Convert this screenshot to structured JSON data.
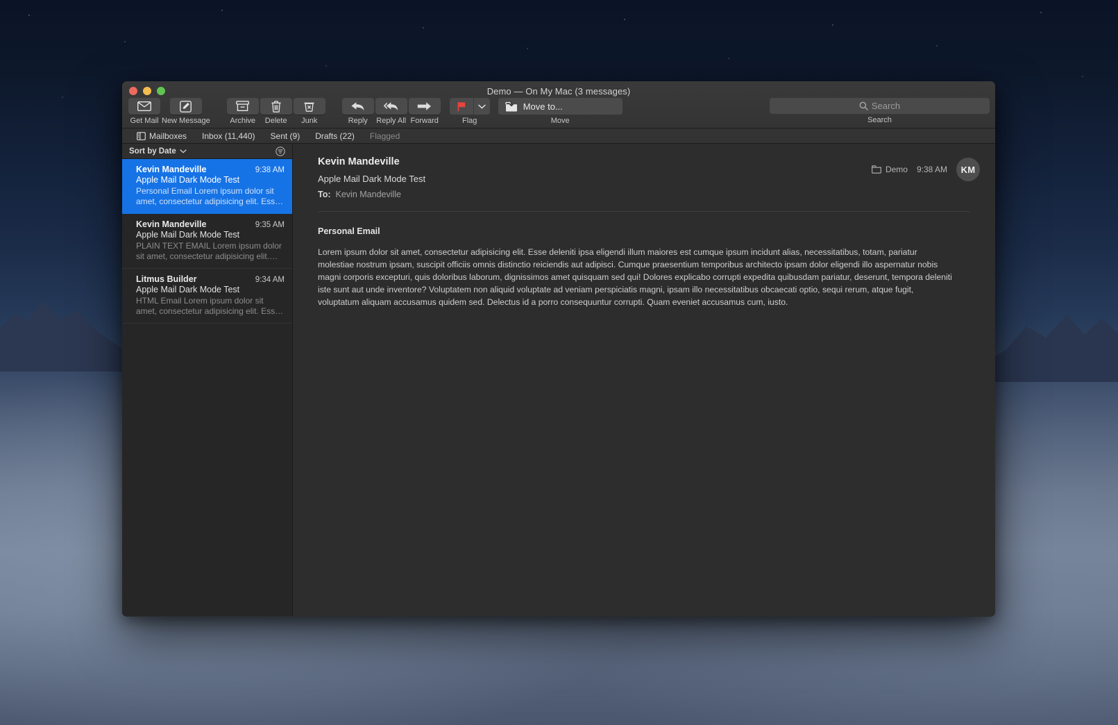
{
  "window": {
    "title": "Demo — On My Mac (3 messages)",
    "traffic_lights": [
      "close",
      "minimize",
      "zoom"
    ],
    "accent_selected": "#1673e6",
    "flag_color": "#e8453c"
  },
  "toolbar": {
    "items": [
      {
        "label": "Get Mail",
        "icon": "envelope-icon"
      },
      {
        "label": "New Message",
        "icon": "compose-icon"
      },
      {
        "label": "Archive",
        "icon": "archive-box-icon"
      },
      {
        "label": "Delete",
        "icon": "trash-icon"
      },
      {
        "label": "Junk",
        "icon": "junk-bin-icon"
      },
      {
        "label": "Reply",
        "icon": "reply-arrow-icon"
      },
      {
        "label": "Reply All",
        "icon": "reply-all-arrow-icon"
      },
      {
        "label": "Forward",
        "icon": "forward-arrow-icon"
      }
    ],
    "flag": {
      "label": "Flag",
      "icon": "flag-icon",
      "menu_icon": "chevron-down-icon"
    },
    "move": {
      "label": "Move",
      "button_label": "Move to...",
      "icon": "move-to-icon"
    },
    "search": {
      "label": "Search",
      "placeholder": "Search",
      "icon": "search-icon"
    }
  },
  "favorites": {
    "items": [
      {
        "label": "Mailboxes",
        "icon": "sidebar-toggle-icon",
        "dim": false
      },
      {
        "label": "Inbox (11,440)",
        "icon": null,
        "dim": false
      },
      {
        "label": "Sent (9)",
        "icon": null,
        "dim": false
      },
      {
        "label": "Drafts (22)",
        "icon": null,
        "dim": false
      },
      {
        "label": "Flagged",
        "icon": null,
        "dim": true
      }
    ]
  },
  "message_list": {
    "sort_label": "Sort by Date",
    "sort_chevron": "chevron-down-icon",
    "filter_icon": "filter-icon",
    "messages": [
      {
        "sender": "Kevin Mandeville",
        "time": "9:38 AM",
        "subject": "Apple Mail Dark Mode Test",
        "snippet": "Personal Email Lorem ipsum dolor sit amet, consectetur adipisicing elit. Ess…",
        "selected": true
      },
      {
        "sender": "Kevin Mandeville",
        "time": "9:35 AM",
        "subject": "Apple Mail Dark Mode Test",
        "snippet": "PLAIN TEXT EMAIL Lorem ipsum dolor sit amet, consectetur adipisicing elit.…",
        "selected": false
      },
      {
        "sender": "Litmus Builder",
        "time": "9:34 AM",
        "subject": "Apple Mail Dark Mode Test",
        "snippet": "HTML Email Lorem ipsum dolor sit amet, consectetur adipisicing elit. Ess…",
        "selected": false
      }
    ]
  },
  "reading_pane": {
    "sender": "Kevin Mandeville",
    "subject": "Apple Mail Dark Mode Test",
    "to_label": "To:",
    "to_value": "Kevin Mandeville",
    "folder": "Demo",
    "folder_icon": "folder-icon",
    "time": "9:38 AM",
    "avatar_initials": "KM",
    "body_heading": "Personal Email",
    "body_text": "Lorem ipsum dolor sit amet, consectetur adipisicing elit. Esse deleniti ipsa eligendi illum maiores est cumque ipsum incidunt alias, necessitatibus, totam, pariatur molestiae nostrum ipsam, suscipit officiis omnis distinctio reiciendis aut adipisci. Cumque praesentium temporibus architecto ipsam dolor eligendi illo aspernatur nobis magni corporis excepturi, quis doloribus laborum, dignissimos amet quisquam sed qui! Dolores explicabo corrupti expedita quibusdam pariatur, deserunt, tempora deleniti iste sunt aut unde inventore? Voluptatem non aliquid voluptate ad veniam perspiciatis magni, ipsam illo necessitatibus obcaecati optio, sequi rerum, atque fugit, voluptatum aliquam accusamus quidem sed. Delectus id a porro consequuntur corrupti. Quam eveniet accusamus cum, iusto."
  }
}
